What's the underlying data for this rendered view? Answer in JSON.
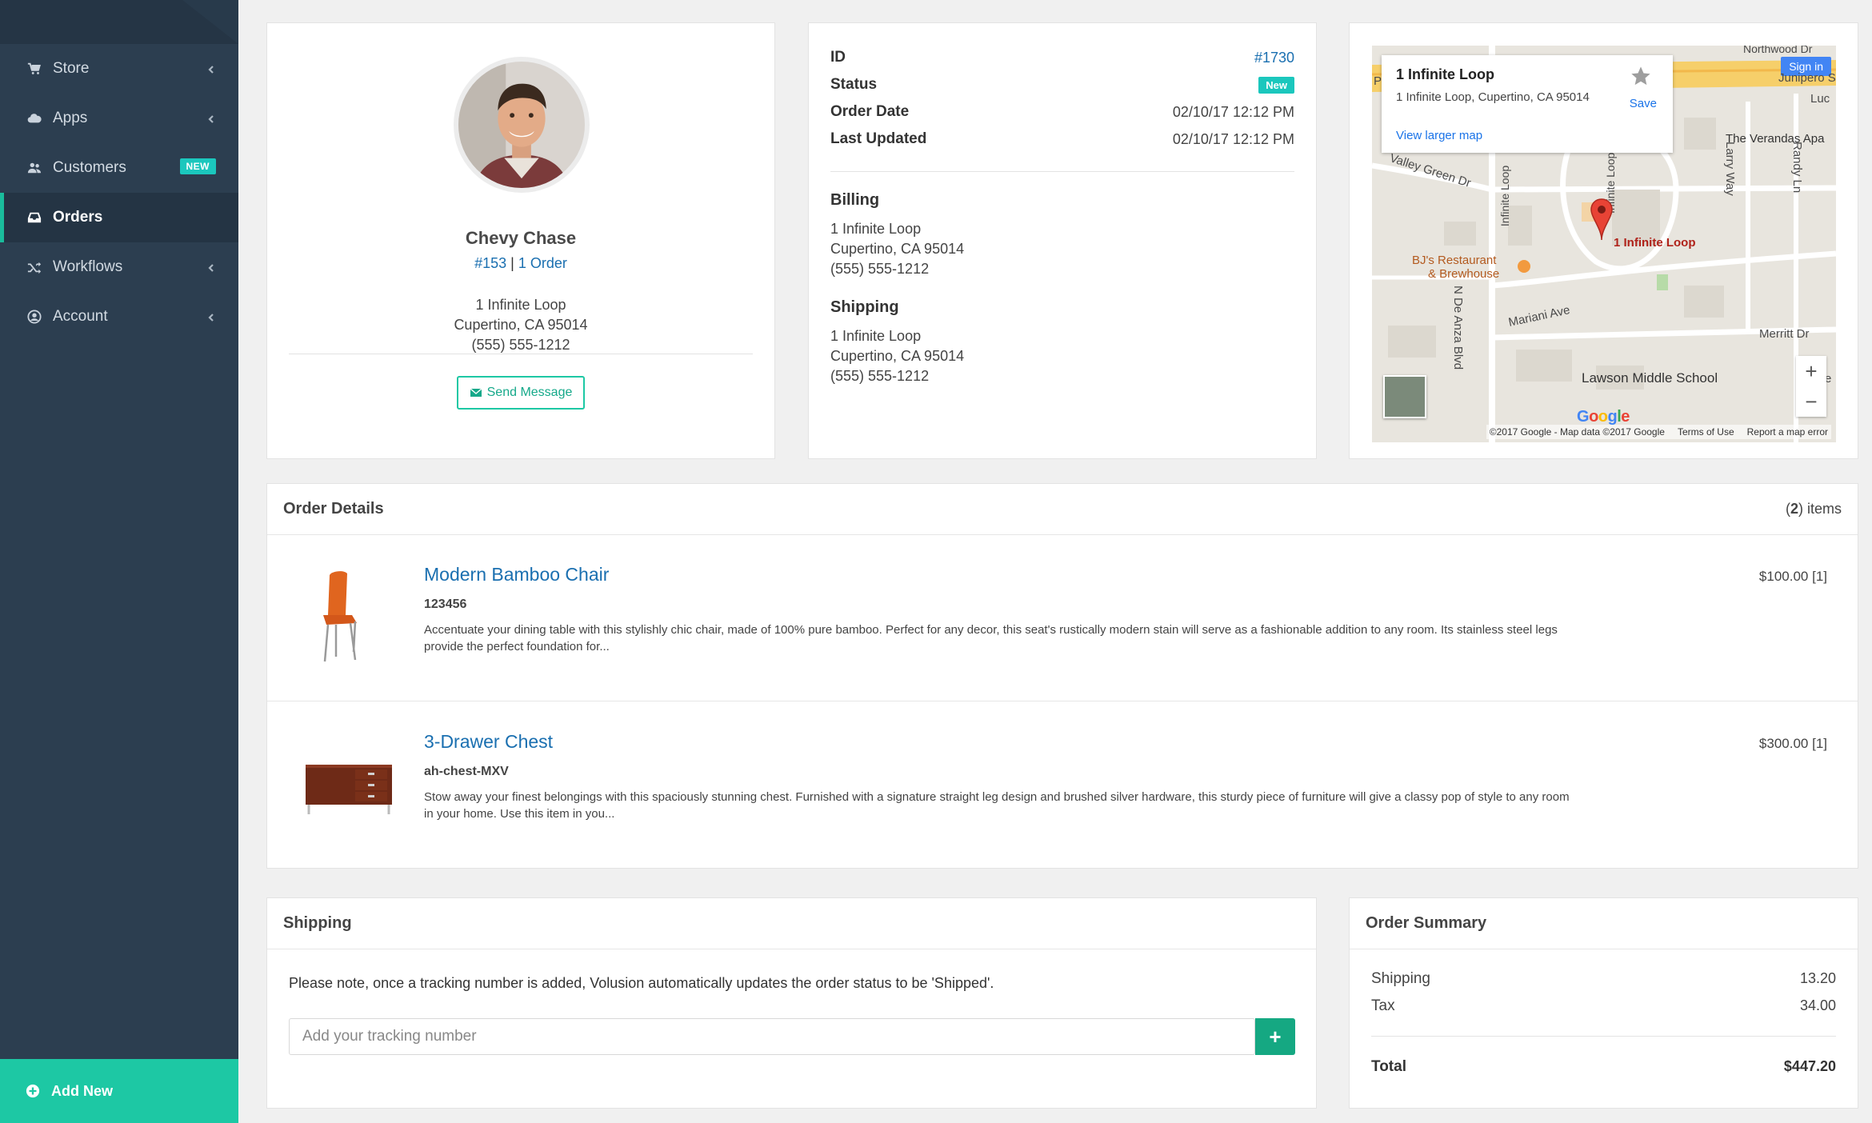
{
  "sidebar": {
    "items": [
      {
        "label": "Store",
        "icon": "cart-icon",
        "has_chevron": true
      },
      {
        "label": "Apps",
        "icon": "cloud-icon",
        "has_chevron": true
      },
      {
        "label": "Customers",
        "icon": "users-icon",
        "badge": "NEW"
      },
      {
        "label": "Orders",
        "icon": "inbox-icon",
        "active": true
      },
      {
        "label": "Workflows",
        "icon": "shuffle-icon",
        "has_chevron": true
      },
      {
        "label": "Account",
        "icon": "user-circle-icon",
        "has_chevron": true
      }
    ],
    "add_new_label": "Add New"
  },
  "customer": {
    "name": "Chevy Chase",
    "id_link": "#153",
    "separator": "|",
    "orders_link": "1 Order",
    "address_line1": "1 Infinite Loop",
    "address_line2": "Cupertino, CA 95014",
    "phone": "(555) 555-1212",
    "send_message_label": "Send Message"
  },
  "order": {
    "id_label": "ID",
    "id_value": "#1730",
    "status_label": "Status",
    "status_value": "New",
    "order_date_label": "Order Date",
    "order_date_value": "02/10/17 12:12 PM",
    "last_updated_label": "Last Updated",
    "last_updated_value": "02/10/17 12:12 PM",
    "billing_label": "Billing",
    "billing_line1": "1 Infinite Loop",
    "billing_line2": "Cupertino, CA 95014",
    "billing_phone": "(555) 555-1212",
    "shipping_label": "Shipping",
    "shipping_line1": "1 Infinite Loop",
    "shipping_line2": "Cupertino, CA 95014",
    "shipping_phone": "(555) 555-1212"
  },
  "map": {
    "info_title": "1 Infinite Loop",
    "info_address": "1 Infinite Loop, Cupertino, CA 95014",
    "view_larger": "View larger map",
    "save_label": "Save",
    "sign_in": "Sign in",
    "pin_label": "1 Infinite Loop",
    "labels": {
      "northwood": "Northwood Dr",
      "junipero": "Junipero S",
      "luc": "Luc",
      "verandas": "The Verandas Apa",
      "valley_green": "Valley Green Dr",
      "infinite_loop_road": "Infinite Loop",
      "larry_way": "Larry Way",
      "randy_ln": "Randy Ln",
      "bjs": "BJ's Restaurant",
      "brewhouse": "& Brewhouse",
      "n_de_anza": "N De Anza Blvd",
      "mariani": "Mariani Ave",
      "merritt": "Merritt Dr",
      "lawson": "Lawson Middle School",
      "pe": "Pe",
      "e": "e"
    },
    "google": "Google",
    "footer_copyright": "©2017 Google - Map data ©2017 Google",
    "footer_terms": "Terms of Use",
    "footer_report": "Report a map error",
    "zoom_in": "+",
    "zoom_out": "−"
  },
  "order_details": {
    "title": "Order Details",
    "count_number": "2",
    "count_suffix": " items",
    "items": [
      {
        "title": "Modern Bamboo Chair",
        "sku": "123456",
        "description": "Accentuate your dining table with this stylishly chic chair, made of 100% pure bamboo. Perfect for any decor, this seat's rustically modern stain will serve as a fashionable addition to any room. Its stainless steel legs provide the perfect foundation for...",
        "price": "$100.00 [1]"
      },
      {
        "title": "3-Drawer Chest",
        "sku": "ah-chest-MXV",
        "description": "Stow away your finest belongings with this spaciously stunning chest. Furnished with a signature straight leg design and brushed silver hardware, this sturdy piece of furniture will give a classy pop of style to any room in your home. Use this item in you...",
        "price": "$300.00 [1]"
      }
    ]
  },
  "shipping": {
    "title": "Shipping",
    "note": "Please note, once a tracking number is added, Volusion automatically updates the order status to be 'Shipped'.",
    "tracking_placeholder": "Add your tracking number",
    "tracking_value": "",
    "add_label": "+"
  },
  "summary": {
    "title": "Order Summary",
    "shipping_label": "Shipping",
    "shipping_value": "13.20",
    "tax_label": "Tax",
    "tax_value": "34.00",
    "total_label": "Total",
    "total_value": "$447.20"
  },
  "colors": {
    "sidebar_bg": "#2c3e50",
    "accent": "#1dc8a4",
    "link": "#1a6fb0",
    "badge": "#1bc7bd"
  }
}
